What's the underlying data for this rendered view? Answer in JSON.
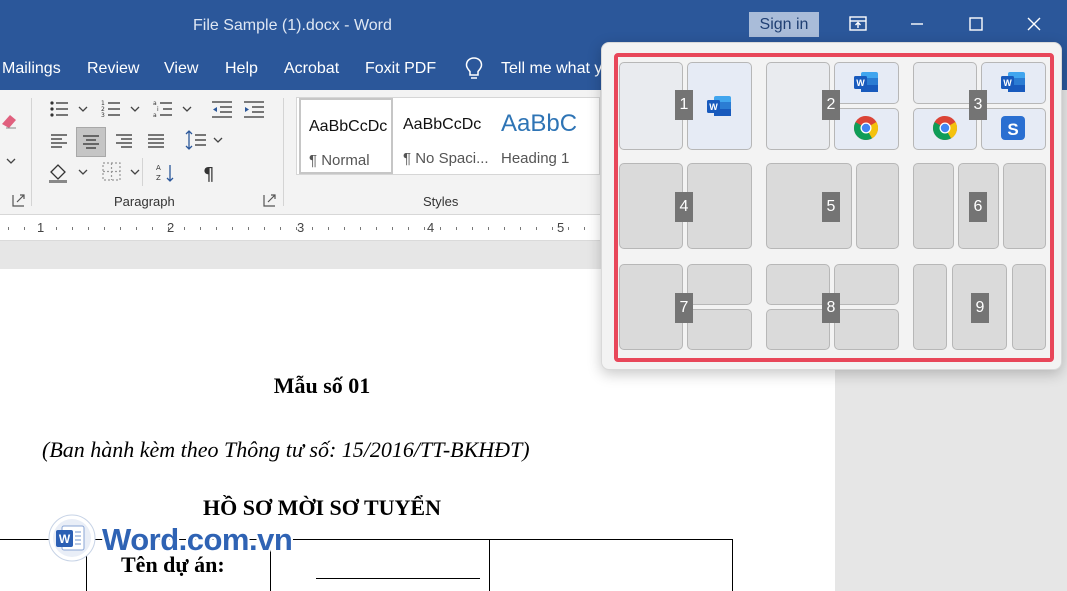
{
  "window": {
    "title": "File Sample (1).docx  -  Word",
    "signin_label": "Sign in"
  },
  "menu": {
    "tabs": [
      "Mailings",
      "Review",
      "View",
      "Help",
      "Acrobat",
      "Foxit PDF"
    ],
    "tell_me": "Tell me what y"
  },
  "ribbon": {
    "paragraph_group_label": "Paragraph",
    "styles_group_label": "Styles",
    "styles": [
      {
        "sample": "AaBbCcDc",
        "name": "¶ Normal"
      },
      {
        "sample": "AaBbCcDc",
        "name": "¶ No Spaci..."
      },
      {
        "sample": "AaBbC",
        "name": "Heading 1"
      }
    ]
  },
  "ruler": {
    "numbers": [
      "1",
      "2",
      "3",
      "4",
      "5"
    ]
  },
  "document": {
    "heading": "Mẫu số 01",
    "subtitle": "(Ban hành kèm theo Thông tư số: 15/2016/TT-BKHĐT)",
    "title": "HỒ SƠ MỜI SƠ TUYỂN",
    "table_label": "Tên dự án:"
  },
  "watermark": {
    "text": "Word.com.vn"
  },
  "snap_layouts": {
    "layouts": [
      {
        "number": "1",
        "apps": [
          "word-icon"
        ]
      },
      {
        "number": "2",
        "apps": [
          "word-icon",
          "chrome-icon"
        ]
      },
      {
        "number": "3",
        "apps": [
          "chrome-icon",
          "word-icon",
          "snagit-icon"
        ]
      },
      {
        "number": "4"
      },
      {
        "number": "5"
      },
      {
        "number": "6"
      },
      {
        "number": "7"
      },
      {
        "number": "8"
      },
      {
        "number": "9"
      }
    ],
    "highlight_color": "#e8475a"
  },
  "colors": {
    "word_blue": "#2b579a",
    "heading_blue": "#2e74b5"
  }
}
